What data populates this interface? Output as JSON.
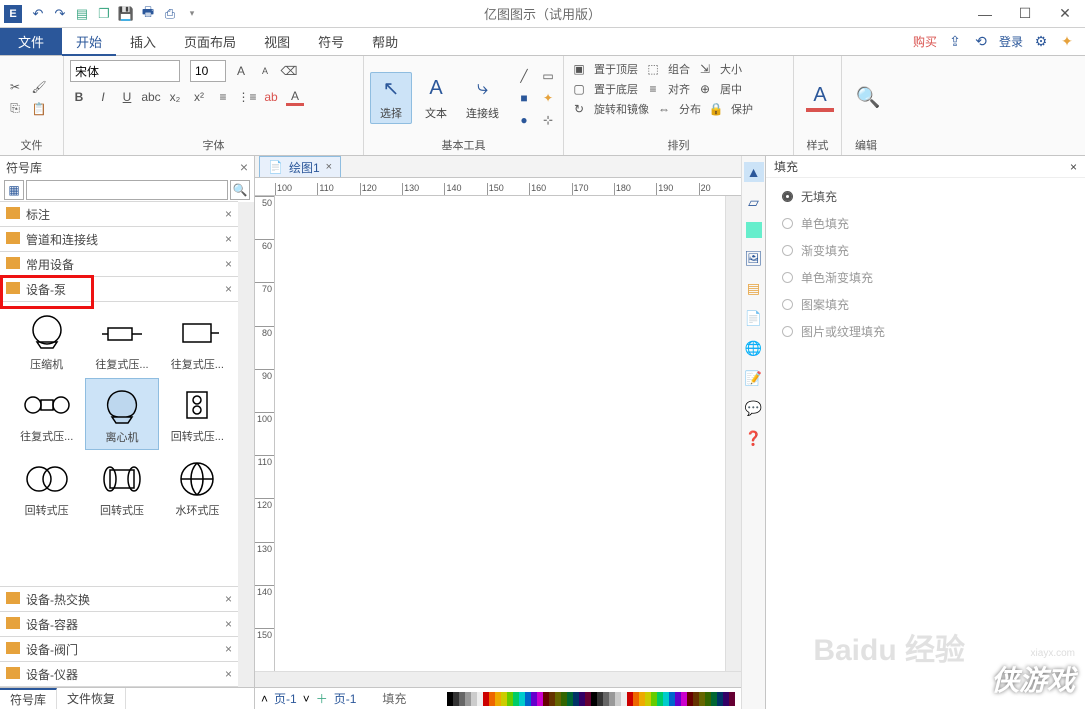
{
  "title": "亿图图示（试用版）",
  "menubar": {
    "file": "文件",
    "tabs": [
      "开始",
      "插入",
      "页面布局",
      "视图",
      "符号",
      "帮助"
    ],
    "activeTab": 0,
    "buy": "购买",
    "login": "登录"
  },
  "ribbon": {
    "groups": {
      "file": "文件",
      "font": "字体",
      "tools": "基本工具",
      "arrange": "排列",
      "style": "样式",
      "edit": "编辑"
    },
    "font_name": "宋体",
    "font_size": "10",
    "tools": {
      "select": "选择",
      "text": "文本",
      "connector": "连接线"
    },
    "arrange": {
      "top": "置于顶层",
      "bottom": "置于底层",
      "rotate": "旋转和镜像",
      "group": "组合",
      "align": "对齐",
      "distribute": "分布",
      "size": "大小",
      "center": "居中",
      "protect": "保护"
    }
  },
  "leftpanel": {
    "header": "符号库",
    "categories": [
      "标注",
      "管道和连接线",
      "常用设备",
      "设备-泵",
      "设备-热交换",
      "设备-容器",
      "设备-阀门",
      "设备-仪器"
    ],
    "highlightIndex": 3,
    "shapes": [
      "压缩机",
      "往复式压...",
      "往复式压...",
      "往复式压...",
      "离心机",
      "回转式压...",
      "回转式压",
      "回转式压",
      "水环式压"
    ],
    "selectedShape": 4,
    "bottomTabs": [
      "符号库",
      "文件恢复"
    ],
    "activeBottomTab": 0
  },
  "docTabs": {
    "name": "绘图1"
  },
  "ruler_h": [
    "100",
    "110",
    "120",
    "130",
    "140",
    "150",
    "160",
    "170",
    "180",
    "190",
    "20"
  ],
  "ruler_v": [
    "50",
    "60",
    "70",
    "80",
    "90",
    "100",
    "110",
    "120",
    "130",
    "140",
    "150"
  ],
  "pageFooter": {
    "pageNav1": "页-1",
    "pageNav2": "页-1",
    "fillLabel": "填充"
  },
  "rightpanel": {
    "header": "填充",
    "options": [
      "无填充",
      "单色填充",
      "渐变填充",
      "单色渐变填充",
      "图案填充",
      "图片或纹理填充"
    ],
    "selected": 0
  },
  "watermark": {
    "site": "xiayx.com",
    "text": "侠游戏",
    "baidu": "Baidu 经验"
  }
}
